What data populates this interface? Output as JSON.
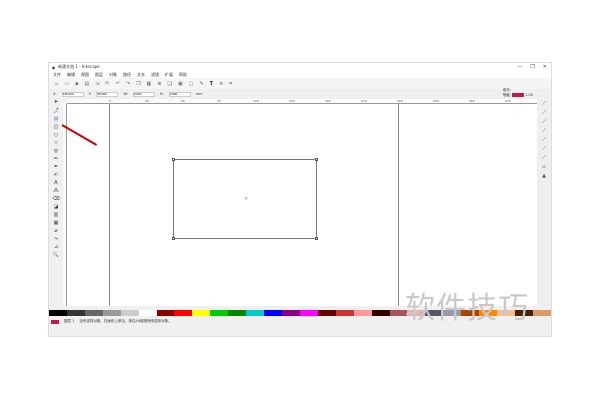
{
  "window": {
    "title": "新建文档 1 - Inkscape",
    "controls": [
      "—",
      "❐",
      "✕"
    ]
  },
  "menu": [
    "文件",
    "编辑",
    "视图",
    "图层",
    "对象",
    "路径",
    "文本",
    "滤镜",
    "扩展",
    "帮助"
  ],
  "controls": {
    "x_label": "X:",
    "x": "145.000",
    "y_label": "Y:",
    "y": "56.000",
    "w_label": "W:",
    "w": "0.000",
    "h_label": "H:",
    "h": "0.000",
    "unit": "mm"
  },
  "ruler_ticks": [
    "0",
    "25",
    "50",
    "75",
    "100",
    "125",
    "150",
    "175",
    "200",
    "225",
    "250",
    "275"
  ],
  "fill_stroke": {
    "fill_label": "填充:",
    "stroke_label": "笔触:",
    "stroke_width": "1.00",
    "fill_color": "#c8174a"
  },
  "status": {
    "layer": "图层 1",
    "message": "没有选择对象。在画布上单击、按住Alt键拖拽来选择对象。"
  },
  "palette": [
    "#000",
    "#333",
    "#666",
    "#999",
    "#ccc",
    "#fff",
    "#800",
    "#f00",
    "#ff0",
    "#0c0",
    "#080",
    "#0cc",
    "#00f",
    "#808",
    "#f0f",
    "#600",
    "#c33",
    "#f99",
    "#300",
    "#a55",
    "#eaa",
    "#556",
    "#99a",
    "#a40",
    "#f80",
    "#fb8",
    "#420",
    "#d96"
  ],
  "watermark": "软件技巧"
}
